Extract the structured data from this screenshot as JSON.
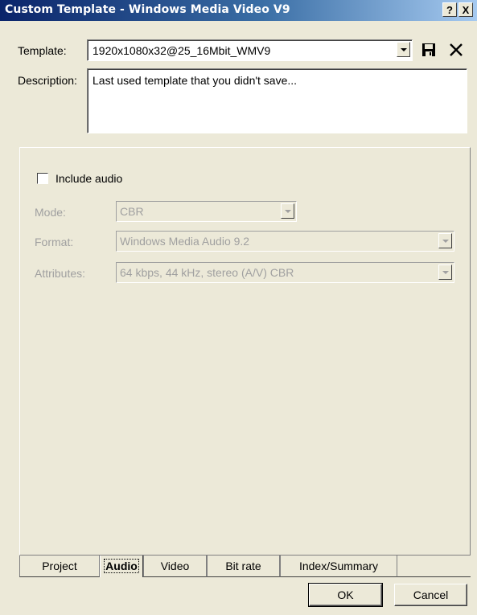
{
  "window": {
    "title": "Custom Template - Windows Media Video V9",
    "help_label": "?",
    "close_label": "X"
  },
  "template": {
    "label": "Template:",
    "value": "1920x1080x32@25_16Mbit_WMV9"
  },
  "description": {
    "label": "Description:",
    "value": "Last used template that you didn't save..."
  },
  "audio": {
    "include_audio_label": "Include audio",
    "include_audio_checked": false,
    "mode_label": "Mode:",
    "mode_value": "CBR",
    "format_label": "Format:",
    "format_value": "Windows Media Audio 9.2",
    "attributes_label": "Attributes:",
    "attributes_value": "64 kbps, 44 kHz, stereo (A/V) CBR"
  },
  "tabs": [
    {
      "label": "Project",
      "active": false
    },
    {
      "label": "Audio",
      "active": true
    },
    {
      "label": "Video",
      "active": false
    },
    {
      "label": "Bit rate",
      "active": false
    },
    {
      "label": "Index/Summary",
      "active": false
    }
  ],
  "buttons": {
    "ok": "OK",
    "cancel": "Cancel"
  },
  "icons": {
    "save": "save-icon",
    "delete": "delete-icon"
  }
}
